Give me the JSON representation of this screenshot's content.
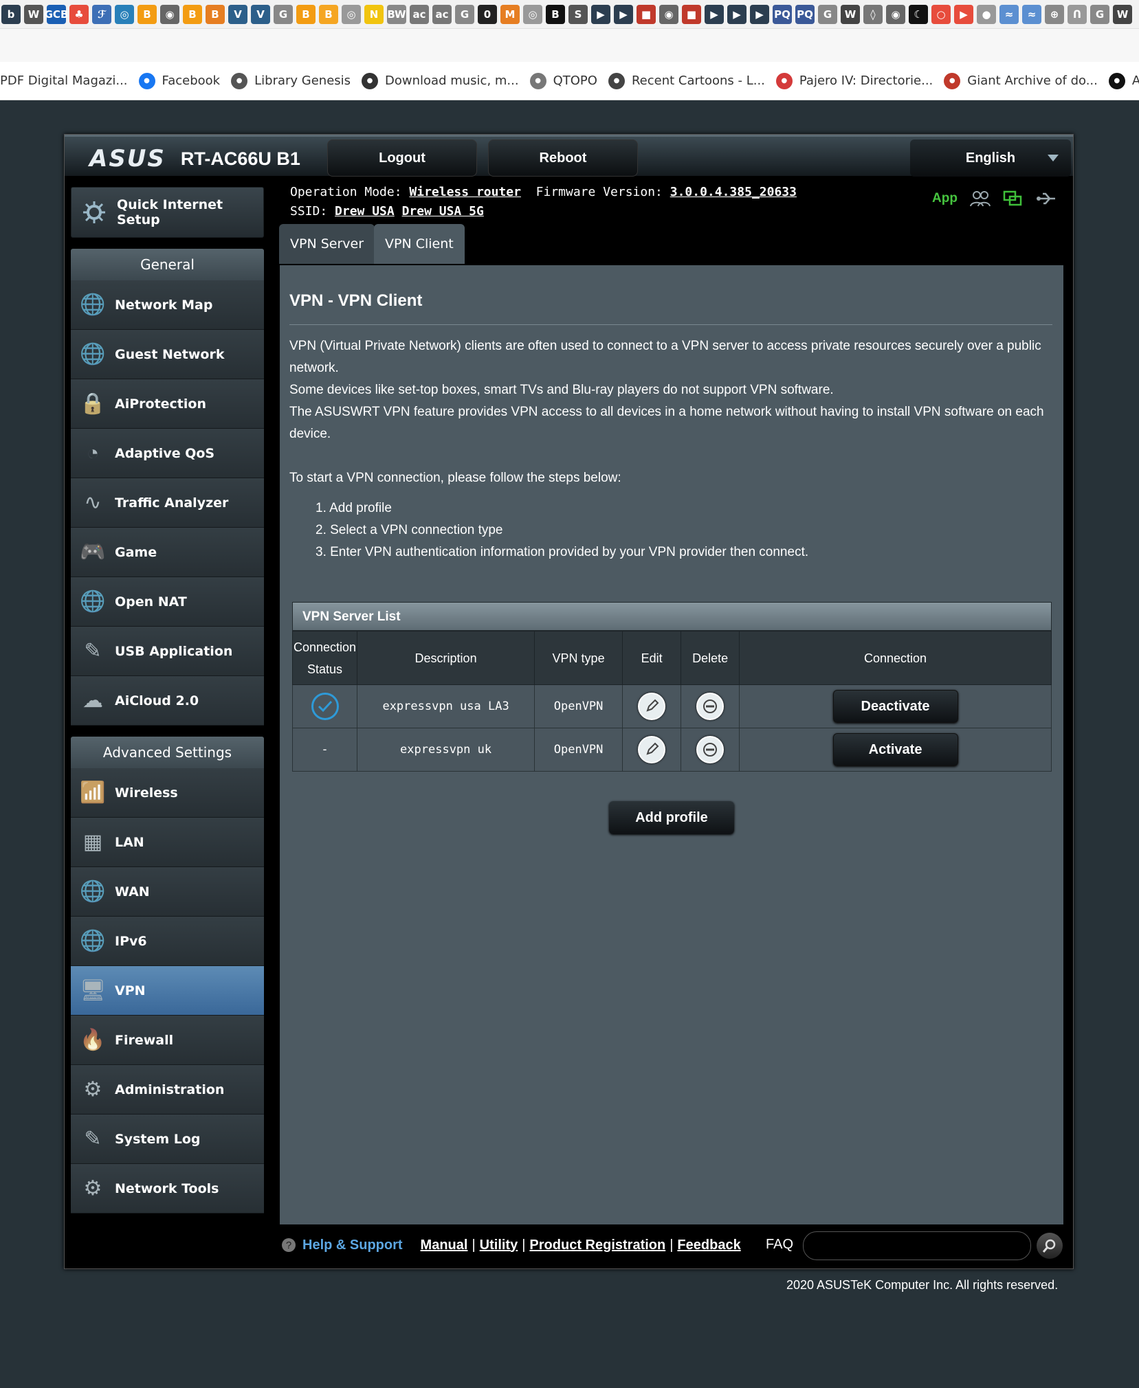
{
  "browser": {
    "favicons": [
      "b",
      "W",
      "GCB",
      "♣",
      "ℱ",
      "◎",
      "B",
      "◉",
      "B",
      "B",
      "V",
      "V",
      "G",
      "B",
      "B",
      "◎",
      "N",
      "BW",
      "ac",
      "ac",
      "G",
      "0",
      "M",
      "◎",
      "B",
      "S",
      "▶",
      "▶",
      "■",
      "◉",
      "■",
      "▶",
      "▶",
      "▶",
      "PQ",
      "PQ",
      "G",
      "W",
      "◊",
      "◉",
      "☾",
      "○",
      "▶",
      "●",
      "≈",
      "≈",
      "⊕",
      "ᑎ",
      "G",
      "W"
    ],
    "bookmarks": [
      {
        "label": "PDF Digital Magazi...",
        "icon": "book-icon",
        "color": "#888888"
      },
      {
        "label": "Facebook",
        "icon": "facebook-icon",
        "color": "#1877f2"
      },
      {
        "label": "Library Genesis",
        "icon": "library-icon",
        "color": "#555555"
      },
      {
        "label": "Download music, m...",
        "icon": "car-icon",
        "color": "#333333"
      },
      {
        "label": "QTOPO",
        "icon": "seal-icon",
        "color": "#777777"
      },
      {
        "label": "Recent Cartoons - L...",
        "icon": "cartoon-icon",
        "color": "#444444"
      },
      {
        "label": "Pajero IV: Directorie...",
        "icon": "pajero-icon",
        "color": "#d43a3a"
      },
      {
        "label": "Giant Archive of do...",
        "icon": "archive-icon",
        "color": "#c0392b"
      },
      {
        "label": "ADALI",
        "icon": "play-icon",
        "color": "#111111"
      }
    ]
  },
  "router": {
    "brand": "ASUS",
    "model": "RT-AC66U B1",
    "logout": "Logout",
    "reboot": "Reboot",
    "language": "English",
    "op_mode_label": "Operation Mode:",
    "op_mode": "Wireless router",
    "firmware_label": "Firmware Version:",
    "firmware": "3.0.0.4.385_20633",
    "ssid_label": "SSID:",
    "ssid_1": "Drew USA",
    "ssid_2": "Drew USA 5G",
    "app_label": "App"
  },
  "sidebar": {
    "quick_setup": "Quick Internet Setup",
    "general_title": "General",
    "general": [
      {
        "label": "Network Map",
        "icon": "network-map-icon",
        "glyph": "🌐"
      },
      {
        "label": "Guest Network",
        "icon": "guest-network-icon",
        "glyph": "🌐"
      },
      {
        "label": "AiProtection",
        "icon": "lock-icon",
        "glyph": "🔒"
      },
      {
        "label": "Adaptive QoS",
        "icon": "gauge-icon",
        "glyph": "◔"
      },
      {
        "label": "Traffic Analyzer",
        "icon": "pulse-icon",
        "glyph": "∿"
      },
      {
        "label": "Game",
        "icon": "gamepad-icon",
        "glyph": "🎮"
      },
      {
        "label": "Open NAT",
        "icon": "open-nat-icon",
        "glyph": "🌐"
      },
      {
        "label": "USB Application",
        "icon": "usb-icon",
        "glyph": "✎"
      },
      {
        "label": "AiCloud 2.0",
        "icon": "cloud-icon",
        "glyph": "☁"
      }
    ],
    "advanced_title": "Advanced Settings",
    "advanced": [
      {
        "label": "Wireless",
        "icon": "wireless-icon",
        "glyph": "📶"
      },
      {
        "label": "LAN",
        "icon": "lan-icon",
        "glyph": "▦"
      },
      {
        "label": "WAN",
        "icon": "globe-icon",
        "glyph": "🌐"
      },
      {
        "label": "IPv6",
        "icon": "ipv6-icon",
        "glyph": "🌐"
      },
      {
        "label": "VPN",
        "icon": "vpn-monitor-icon",
        "glyph": "🖥",
        "active": true
      },
      {
        "label": "Firewall",
        "icon": "firewall-icon",
        "glyph": "🔥"
      },
      {
        "label": "Administration",
        "icon": "admin-gear-icon",
        "glyph": "⚙"
      },
      {
        "label": "System Log",
        "icon": "system-log-icon",
        "glyph": "✎"
      },
      {
        "label": "Network Tools",
        "icon": "network-tools-icon",
        "glyph": "⚙"
      }
    ]
  },
  "tabs": {
    "vpn_server": "VPN Server",
    "vpn_client": "VPN Client"
  },
  "content": {
    "title": "VPN - VPN Client",
    "para1": "VPN (Virtual Private Network) clients are often used to connect to a VPN server to access private resources securely over a public network.",
    "para2": "Some devices like set-top boxes, smart TVs and Blu-ray players do not support VPN software.",
    "para3": "The ASUSWRT VPN feature provides VPN access to all devices in a home network without having to install VPN software on each device.",
    "steps_intro": "To start a VPN connection, please follow the steps below:",
    "steps": [
      "1. Add profile",
      "2. Select a VPN connection type",
      "3. Enter VPN authentication information provided by your VPN provider then connect."
    ]
  },
  "vpn_table": {
    "title": "VPN Server List",
    "headers": [
      "Connection Status",
      "Description",
      "VPN type",
      "Edit",
      "Delete",
      "Connection"
    ],
    "rows": [
      {
        "status": "connected",
        "status_text": "",
        "description": "expressvpn usa LA3",
        "type": "OpenVPN",
        "action": "Deactivate"
      },
      {
        "status": "none",
        "status_text": "-",
        "description": "expressvpn uk",
        "type": "OpenVPN",
        "action": "Activate"
      }
    ],
    "add_profile": "Add profile"
  },
  "footer": {
    "help": "Help & Support",
    "manual": "Manual",
    "utility": "Utility",
    "product_registration": "Product Registration",
    "feedback": "Feedback",
    "faq": "FAQ",
    "copyright": "2020 ASUSTeK Computer Inc. All rights reserved."
  },
  "colors": {
    "accent_blue": "#2e9ad8",
    "active_menu": "#4a79a8",
    "app_green": "#46c43f"
  }
}
